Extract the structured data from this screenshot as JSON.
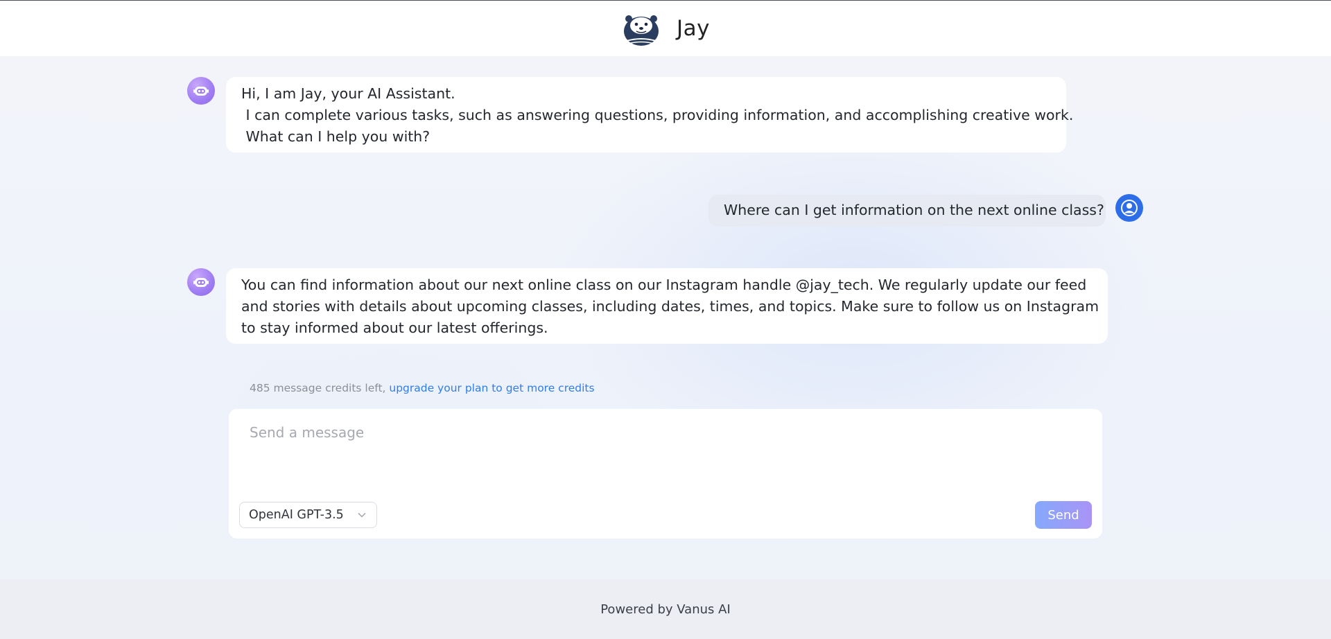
{
  "header": {
    "brand_name": "Jay"
  },
  "messages": [
    {
      "role": "assistant",
      "lines": [
        "Hi, I am Jay, your AI Assistant.",
        " I can complete various tasks, such as answering questions, providing information, and accomplishing creative work.",
        " What can I help you with?"
      ]
    },
    {
      "role": "user",
      "lines": [
        "Where can I get information on the next online class?"
      ]
    },
    {
      "role": "assistant",
      "lines": [
        "You can find information about our next online class on our Instagram handle @jay_tech. We regularly update our feed",
        "and stories with details about upcoming classes, including dates, times, and topics. Make sure to follow us on Instagram",
        "to stay informed about our latest offerings."
      ]
    }
  ],
  "credits": {
    "text": "485 message credits left, ",
    "upgrade_link": "upgrade your plan to get more credits"
  },
  "composer": {
    "placeholder": "Send a message",
    "model_selected": "OpenAI GPT-3.5",
    "send_label": "Send"
  },
  "footer": {
    "text": "Powered by Vanus AI"
  },
  "colors": {
    "accent_blue": "#2d6ee8",
    "bot_avatar": "#9f7cf2",
    "send_button_start": "#86a9fb",
    "send_button_end": "#a993f7",
    "link": "#2f7de9"
  },
  "icons": {
    "logo": "sea-otter-logo",
    "bot_avatar": "robot-icon",
    "user_avatar": "user-circle-icon",
    "select_chevron": "chevron-down-icon"
  }
}
